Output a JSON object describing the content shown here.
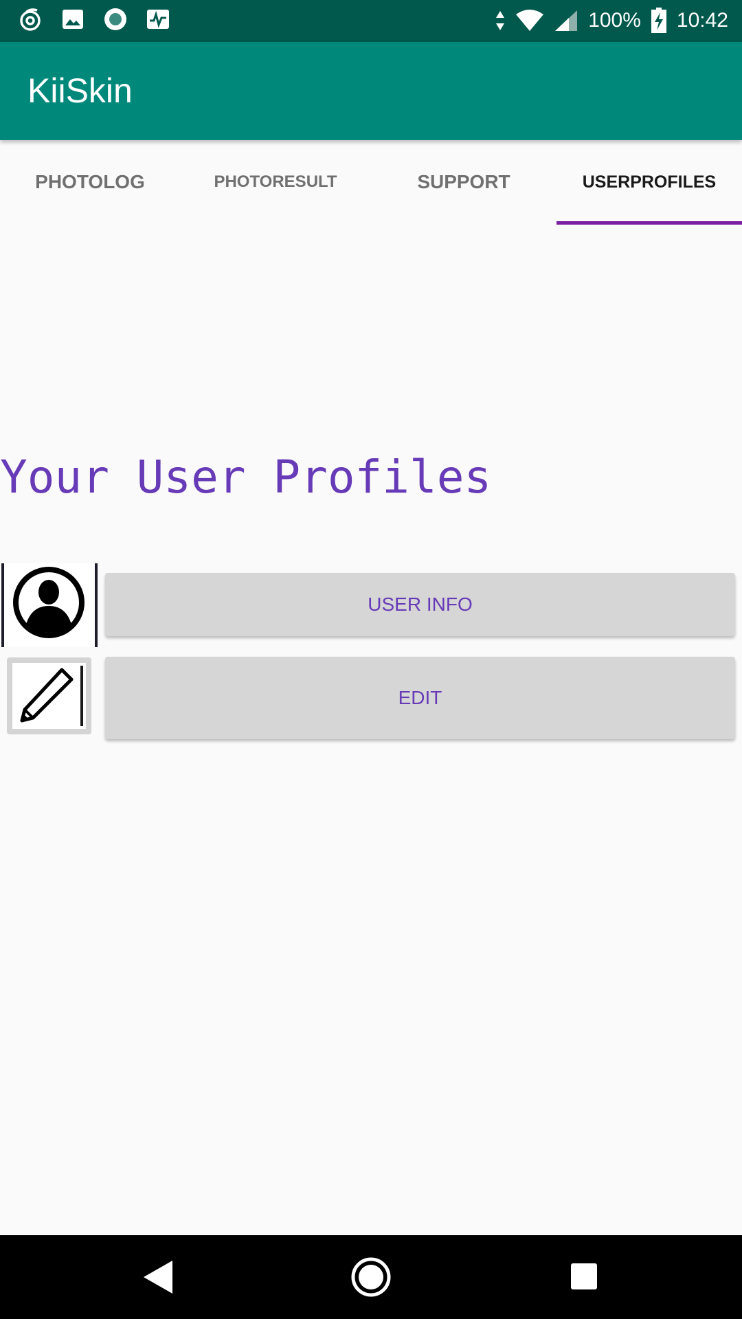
{
  "status_bar": {
    "icons": [
      "hotspot-swirl-icon",
      "image-icon",
      "record-icon",
      "activity-icon"
    ],
    "battery": "100%",
    "time": "10:42"
  },
  "app_bar": {
    "title": "KiiSkin"
  },
  "tabs": [
    {
      "label": "PHOTOLOG",
      "active": false
    },
    {
      "label": "PHOTORESULT",
      "active": false
    },
    {
      "label": "SUPPORT",
      "active": false
    },
    {
      "label": "USERPROFILES",
      "active": true
    }
  ],
  "main": {
    "heading": "Your User Profiles",
    "user_info_button": "USER INFO",
    "edit_button": "EDIT"
  },
  "colors": {
    "status_bar": "#00594c",
    "app_bar": "#00897b",
    "accent": "#673ab7",
    "tab_indicator": "#7b1fa2",
    "button_bg": "#d6d6d6"
  },
  "nav_bar": {
    "icons": [
      "back-icon",
      "home-icon",
      "recents-icon"
    ]
  }
}
